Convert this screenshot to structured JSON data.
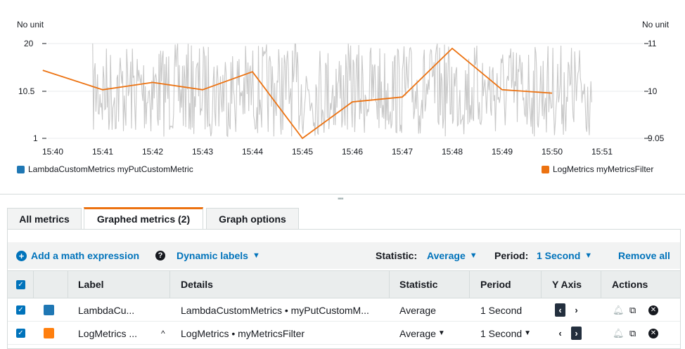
{
  "chart": {
    "left_unit": "No unit",
    "right_unit": "No unit",
    "left_ticks": [
      "20",
      "10.5",
      "1"
    ],
    "right_ticks": [
      "11",
      "10",
      "9.05"
    ],
    "x_ticks": [
      "15:40",
      "15:41",
      "15:42",
      "15:43",
      "15:44",
      "15:45",
      "15:46",
      "15:47",
      "15:48",
      "15:49",
      "15:50",
      "15:51"
    ],
    "legend_left": "LambdaCustomMetrics myPutCustomMetric",
    "legend_right": "LogMetrics myMetricsFilter"
  },
  "chart_data": {
    "type": "line",
    "x_range": [
      "15:40",
      "15:51"
    ],
    "ylim_left": [
      1,
      20
    ],
    "ylim_right": [
      9.05,
      11
    ],
    "series": [
      {
        "name": "LambdaCustomMetrics myPutCustomMetric",
        "axis": "left",
        "color": "#c9c9c9",
        "note_visible": "dense noisy signal from 15:40.8 to 15:50.8 oscillating between 1 and 20",
        "values": []
      },
      {
        "name": "LogMetrics myMetricsFilter",
        "axis": "right",
        "color": "#ec7211",
        "x": [
          "15:39.8",
          "15:41",
          "15:42",
          "15:43",
          "15:44",
          "15:45",
          "15:46",
          "15:47",
          "15:48",
          "15:49",
          "15:50"
        ],
        "values": [
          10.45,
          10.05,
          10.2,
          10.05,
          10.42,
          9.05,
          9.8,
          9.9,
          10.9,
          10.05,
          9.98
        ]
      }
    ]
  },
  "tabs": [
    {
      "label": "All metrics"
    },
    {
      "label": "Graphed metrics (2)"
    },
    {
      "label": "Graph options"
    }
  ],
  "toolbar": {
    "add_math": "Add a math expression",
    "dynamic_labels": "Dynamic labels",
    "statistic_label": "Statistic:",
    "statistic_value": "Average",
    "period_label": "Period:",
    "period_value": "1 Second",
    "remove_all": "Remove all"
  },
  "table": {
    "headers": [
      "Label",
      "Details",
      "Statistic",
      "Period",
      "Y Axis",
      "Actions"
    ],
    "rows": [
      {
        "label": "LambdaCu...",
        "details": "LambdaCustomMetrics • myPutCustomM...",
        "statistic": "Average",
        "period": "1 Second",
        "color": "#1f77b4"
      },
      {
        "label": "LogMetrics ...",
        "details": "LogMetrics • myMetricsFilter",
        "statistic": "Average",
        "period": "1 Second",
        "color": "#ff7f0e"
      }
    ]
  },
  "colors": {
    "accent": "#0073bb",
    "tab_active": "#ec7211",
    "lambda_series": "#1f77b4",
    "log_series": "#ff7f0e"
  }
}
